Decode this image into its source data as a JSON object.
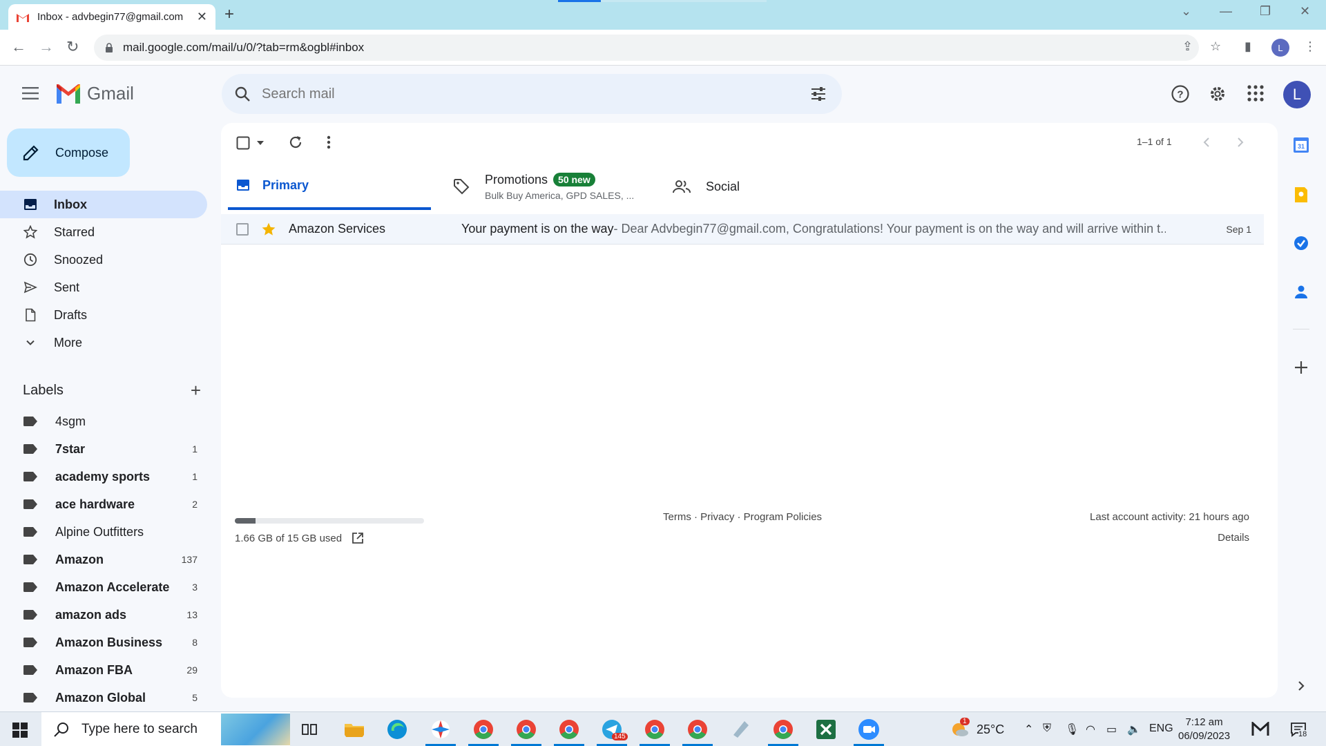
{
  "browser": {
    "tab_title": "Inbox - advbegin77@gmail.com",
    "url": "mail.google.com/mail/u/0/?tab=rm&ogbl#inbox",
    "profile_initial": "L"
  },
  "gmail": {
    "logo_text": "Gmail",
    "search_placeholder": "Search mail",
    "avatar_initial": "L",
    "compose_label": "Compose"
  },
  "nav": [
    {
      "label": "Inbox",
      "icon": "inbox-icon",
      "active": true
    },
    {
      "label": "Starred",
      "icon": "star-icon"
    },
    {
      "label": "Snoozed",
      "icon": "clock-icon"
    },
    {
      "label": "Sent",
      "icon": "send-icon"
    },
    {
      "label": "Drafts",
      "icon": "draft-icon"
    },
    {
      "label": "More",
      "icon": "chevron-down-icon"
    }
  ],
  "labels_header": "Labels",
  "labels": [
    {
      "name": "4sgm",
      "count": "",
      "bold": false
    },
    {
      "name": "7star",
      "count": "1",
      "bold": true
    },
    {
      "name": "academy sports",
      "count": "1",
      "bold": true
    },
    {
      "name": "ace hardware",
      "count": "2",
      "bold": true
    },
    {
      "name": "Alpine Outfitters",
      "count": "",
      "bold": false
    },
    {
      "name": "Amazon",
      "count": "137",
      "bold": true
    },
    {
      "name": "Amazon Accelerate",
      "count": "3",
      "bold": true
    },
    {
      "name": "amazon ads",
      "count": "13",
      "bold": true
    },
    {
      "name": "Amazon Business",
      "count": "8",
      "bold": true
    },
    {
      "name": "Amazon FBA",
      "count": "29",
      "bold": true
    },
    {
      "name": "Amazon Global",
      "count": "5",
      "bold": true
    }
  ],
  "toolbar": {
    "pager": "1–1 of 1"
  },
  "tabs": {
    "primary": "Primary",
    "promotions": "Promotions",
    "promotions_badge": "50 new",
    "promotions_sub": "Bulk Buy America, GPD SALES, ...",
    "social": "Social"
  },
  "emails": [
    {
      "sender": "Amazon Services",
      "subject": "Your payment is on the way",
      "snippet": " - Dear Advbegin77@gmail.com, Congratulations! Your payment is on the way and will arrive within t...",
      "date": "Sep 1",
      "starred": true
    }
  ],
  "footer": {
    "storage": "1.66 GB of 15 GB used",
    "storage_fraction": 0.11,
    "links": "Terms · Privacy · Program Policies",
    "activity": "Last account activity: 21 hours ago",
    "details": "Details"
  },
  "taskbar": {
    "search_placeholder": "Type here to search",
    "temperature": "25°C",
    "language": "ENG",
    "time": "7:12 am",
    "date": "06/09/2023",
    "notifications": "18",
    "weather_badge": "1",
    "telegram_badge": "145"
  },
  "colors": {
    "accent": "#0b57d0",
    "compose_bg": "#c2e7ff",
    "active_nav": "#d3e3fd",
    "badge_green": "#188038"
  }
}
